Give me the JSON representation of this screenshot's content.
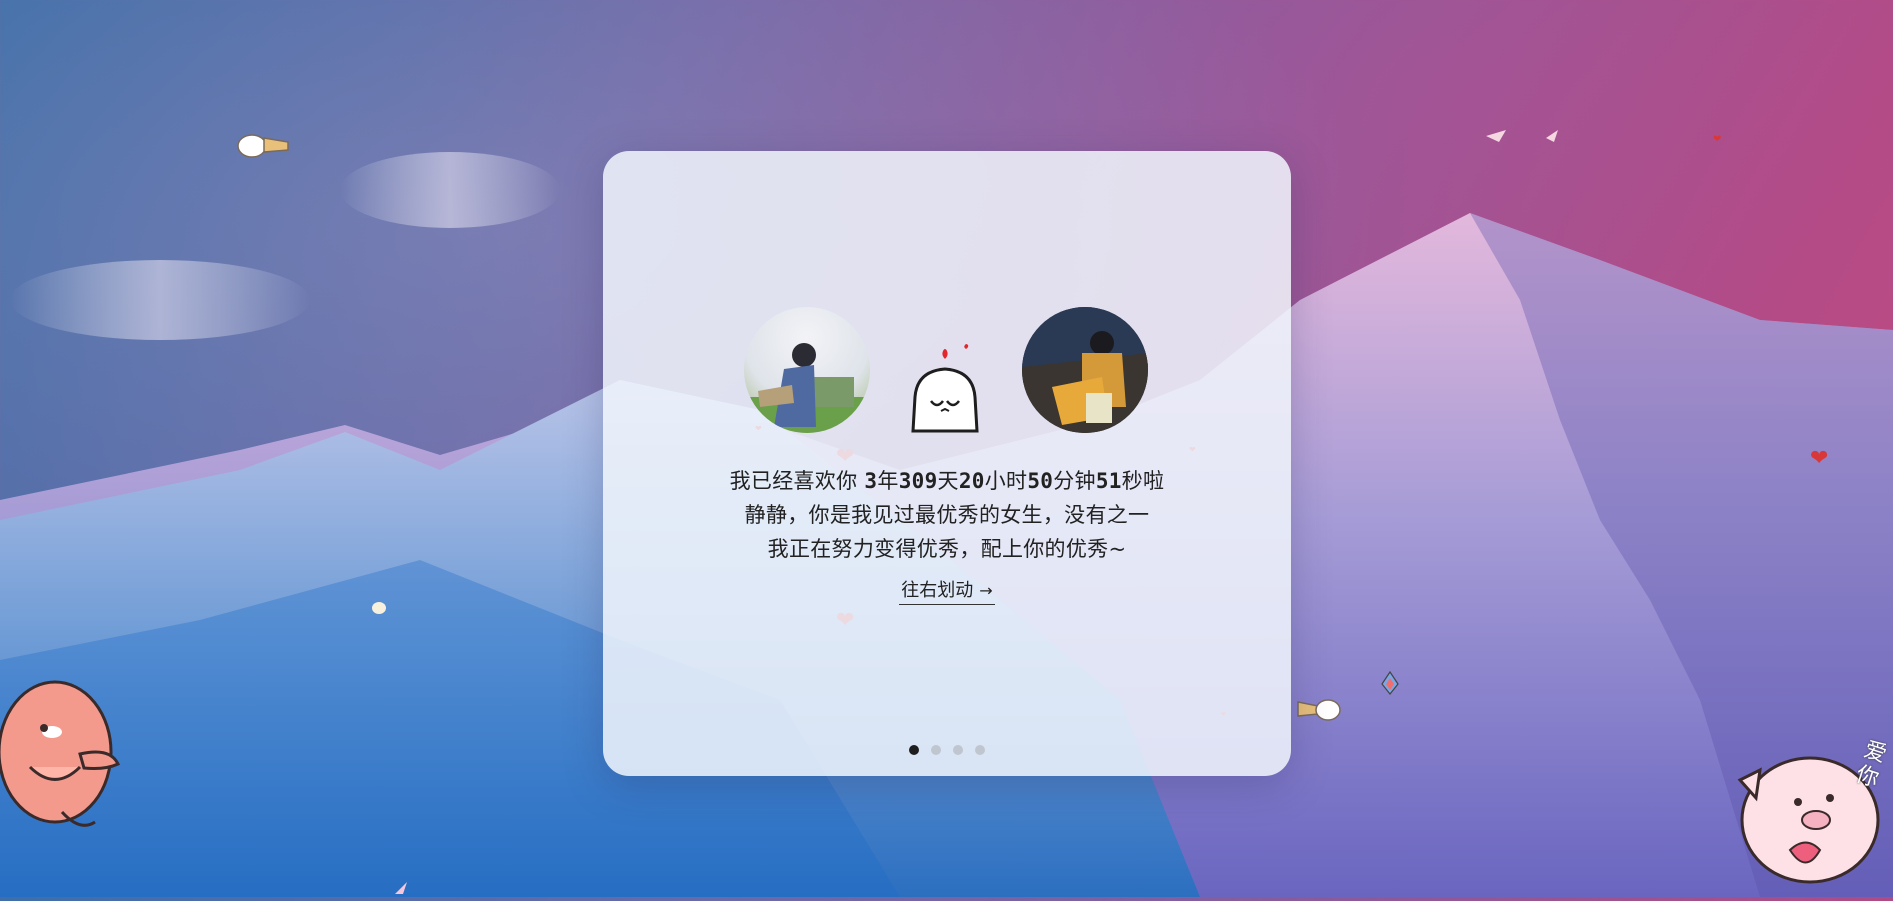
{
  "card": {
    "love_prefix": "我已经喜欢你",
    "duration": {
      "years": "3",
      "years_unit": "年",
      "days": "309",
      "days_unit": "天",
      "hours": "20",
      "hours_unit": "小时",
      "minutes": "50",
      "minutes_unit": "分钟",
      "seconds": "51",
      "seconds_unit": "秒",
      "suffix": "啦"
    },
    "line2": "静静，你是我见过最优秀的女生，没有之一",
    "line3": "我正在努力变得优秀，配上你的优秀~",
    "swipe_label": "往右划动",
    "swipe_arrow": "→",
    "pagination": {
      "total": 4,
      "active": 0
    }
  },
  "decor": {
    "left_avatar_icon": "boy-photo-avatar",
    "right_avatar_icon": "girl-photo-avatar",
    "center_icon": "shy-mascot-icon",
    "hearts_color": "#d93838",
    "sticker_right_text": "爱你"
  }
}
